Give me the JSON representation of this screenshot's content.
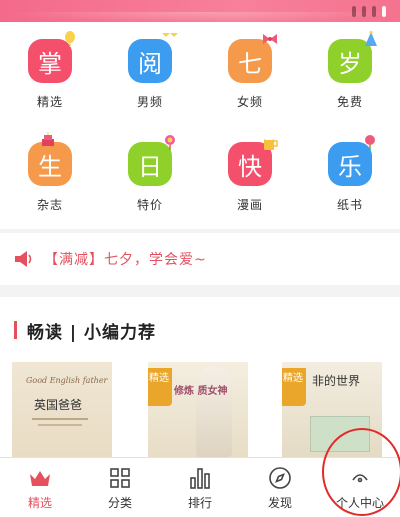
{
  "banner": {
    "dots": 4,
    "active_dot": 3
  },
  "categories": [
    {
      "char": "掌",
      "label": "精选",
      "color": "#f4506c",
      "icon": "balloon-icon"
    },
    {
      "char": "阅",
      "label": "男频",
      "color": "#3c9cf0",
      "icon": "flag-icon"
    },
    {
      "char": "七",
      "label": "女频",
      "color": "#f49a4a",
      "icon": "bow-icon"
    },
    {
      "char": "岁",
      "label": "免费",
      "color": "#8fd02a",
      "icon": "party-hat-icon"
    },
    {
      "char": "生",
      "label": "杂志",
      "color": "#f49a4a",
      "icon": "cake-icon"
    },
    {
      "char": "日",
      "label": "特价",
      "color": "#8fd02a",
      "icon": "candy-icon"
    },
    {
      "char": "快",
      "label": "漫画",
      "color": "#f4506c",
      "icon": "beer-icon"
    },
    {
      "char": "乐",
      "label": "纸书",
      "color": "#3c9cf0",
      "icon": "flower-icon"
    }
  ],
  "notice": {
    "text": "【满减】七夕，学会爱~",
    "color": "#e4505e"
  },
  "section": {
    "title": "畅读 | 小编力荐"
  },
  "books": [
    {
      "title": "英国爸爸",
      "subtitle": "Good English father",
      "tag": ""
    },
    {
      "title": "修炼 质女神",
      "subtitle": "",
      "tag": "精选"
    },
    {
      "title": "非的世界",
      "subtitle": "",
      "tag": "精选"
    }
  ],
  "nav": [
    {
      "label": "精选",
      "icon": "crown-icon",
      "active": true
    },
    {
      "label": "分类",
      "icon": "grid-icon",
      "active": false
    },
    {
      "label": "排行",
      "icon": "bar-chart-icon",
      "active": false
    },
    {
      "label": "发现",
      "icon": "compass-icon",
      "active": false
    },
    {
      "label": "个人中心",
      "icon": "profile-icon",
      "active": false
    }
  ]
}
